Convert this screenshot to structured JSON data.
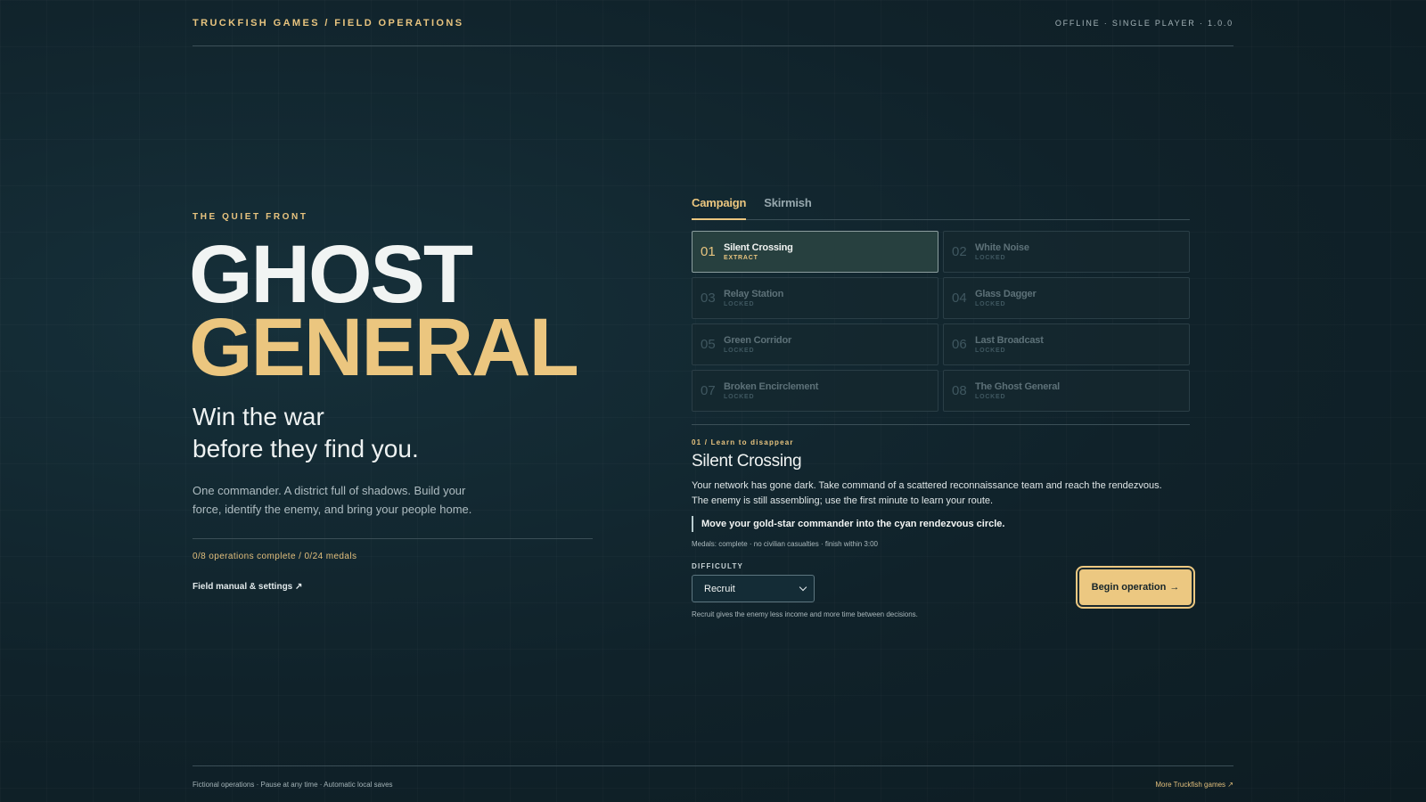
{
  "header": {
    "brand": "TRUCKFISH GAMES / FIELD OPERATIONS",
    "meta": "OFFLINE · SINGLE PLAYER · 1.0.0"
  },
  "hero": {
    "eyebrow": "THE QUIET FRONT",
    "title_line1": "GHOST",
    "title_line2": "GENERAL",
    "tagline_line1": "Win the war",
    "tagline_line2": "before they find you.",
    "description": "One commander. A district full of shadows. Build your force, identify the enemy, and bring your people home.",
    "progress": "0/8 operations complete / 0/24 medals",
    "manual_link": "Field manual & settings",
    "manual_icon": "↗"
  },
  "tabs": [
    {
      "label": "Campaign",
      "active": true
    },
    {
      "label": "Skirmish",
      "active": false
    }
  ],
  "operations": [
    {
      "num": "01",
      "name": "Silent Crossing",
      "status": "EXTRACT",
      "active": true
    },
    {
      "num": "02",
      "name": "White Noise",
      "status": "LOCKED",
      "active": false
    },
    {
      "num": "03",
      "name": "Relay Station",
      "status": "LOCKED",
      "active": false
    },
    {
      "num": "04",
      "name": "Glass Dagger",
      "status": "LOCKED",
      "active": false
    },
    {
      "num": "05",
      "name": "Green Corridor",
      "status": "LOCKED",
      "active": false
    },
    {
      "num": "06",
      "name": "Last Broadcast",
      "status": "LOCKED",
      "active": false
    },
    {
      "num": "07",
      "name": "Broken Encirclement",
      "status": "LOCKED",
      "active": false
    },
    {
      "num": "08",
      "name": "The Ghost General",
      "status": "LOCKED",
      "active": false
    }
  ],
  "briefing": {
    "kicker": "01 / Learn to disappear",
    "name": "Silent Crossing",
    "text": "Your network has gone dark. Take command of a scattered reconnaissance team and reach the rendezvous. The enemy is still assembling; use the first minute to learn your route.",
    "objective": "Move your gold-star commander into the cyan rendezvous circle.",
    "medals": "Medals: complete · no civilian casualties · finish within 3:00",
    "difficulty_label": "DIFFICULTY",
    "difficulty_value": "Recruit",
    "difficulty_note": "Recruit gives the enemy less income and more time between decisions.",
    "begin_label": "Begin operation",
    "begin_icon": "→"
  },
  "footer": {
    "left": "Fictional operations · Pause at any time · Automatic local saves",
    "right": "More Truckfish games",
    "right_icon": "↗"
  },
  "colors": {
    "accent": "#ebc67f",
    "background": "#11232a",
    "locked_text": "#5d7178"
  }
}
